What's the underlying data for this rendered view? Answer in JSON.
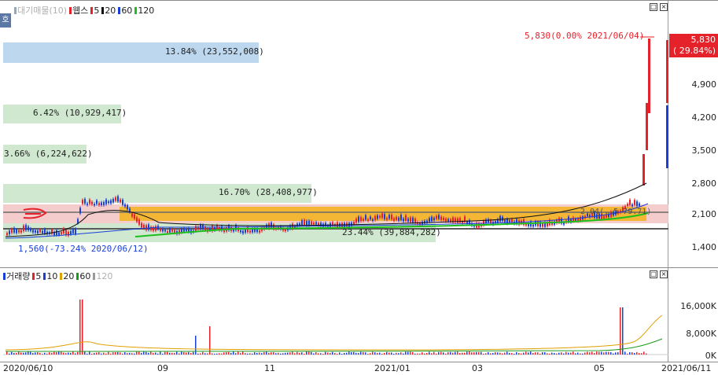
{
  "price_panel": {
    "side_tag": "호",
    "legend": [
      {
        "label": "대기매물(10)",
        "color": "#9aa6b2",
        "faint": true
      },
      {
        "label": "웹스",
        "color": "#e5222a",
        "faint": false
      },
      {
        "label": "5",
        "color": "#e5222a",
        "faint": false
      },
      {
        "label": "20",
        "color": "#111111",
        "faint": false
      },
      {
        "label": "60",
        "color": "#1a3fd6",
        "faint": false
      },
      {
        "label": "120",
        "color": "#1cbf1c",
        "faint": false
      }
    ],
    "buttons": [
      "□",
      "×"
    ],
    "supply_boxes": [
      {
        "text": "13.84% (23,552,008)",
        "color": "#bcd7ee"
      },
      {
        "text": "6.42% (10,929,417)",
        "color": "#cfe8cf"
      },
      {
        "text": "3.66% (6,224,622)",
        "color": "#cfe8cf"
      },
      {
        "text": "16.70% (28,408,977)",
        "color": "#cfe8cf"
      },
      {
        "text": "23.44% (39,884,282)",
        "color": "#cfe8cf"
      }
    ],
    "high_annotation": "5,830(0.00% 2021/06/04)",
    "low_annotation": "1,560(-73.24% 2020/06/12)",
    "current_price": {
      "value": "5,830",
      "change": "( 29.84%)",
      "color": "#e5222a"
    },
    "y_ticks": [
      "4,900",
      "4,200",
      "3,500",
      "2,800",
      "2,100",
      "1,400"
    ],
    "overlay_text": "2,04(..5 79.71)"
  },
  "volume_panel": {
    "legend": [
      {
        "label": "거래량",
        "color": "#1a3fd6",
        "faint": false
      },
      {
        "label": "5",
        "color": "#e5222a",
        "faint": false
      },
      {
        "label": "10",
        "color": "#1a3fd6",
        "faint": false
      },
      {
        "label": "20",
        "color": "#e0a000",
        "faint": false
      },
      {
        "label": "60",
        "color": "#1c9a1c",
        "faint": false
      },
      {
        "label": "120",
        "color": "#9a9a9a",
        "faint": true
      }
    ],
    "buttons": [
      "□",
      "×"
    ],
    "y_ticks": [
      "16,000K",
      "8,000K",
      "0K"
    ]
  },
  "x_axis": {
    "labels": [
      "2020/06/10",
      "09",
      "11",
      "2021/01",
      "03",
      "05",
      "2021/06/11"
    ]
  },
  "colors": {
    "up": "#e5222a",
    "down": "#1a3fd6",
    "band_orange": "#f2b21a",
    "band_pink": "#f4c6c6",
    "ma20": "#111111",
    "ma60": "#1a3fd6",
    "ma120": "#1cbf1c"
  }
}
